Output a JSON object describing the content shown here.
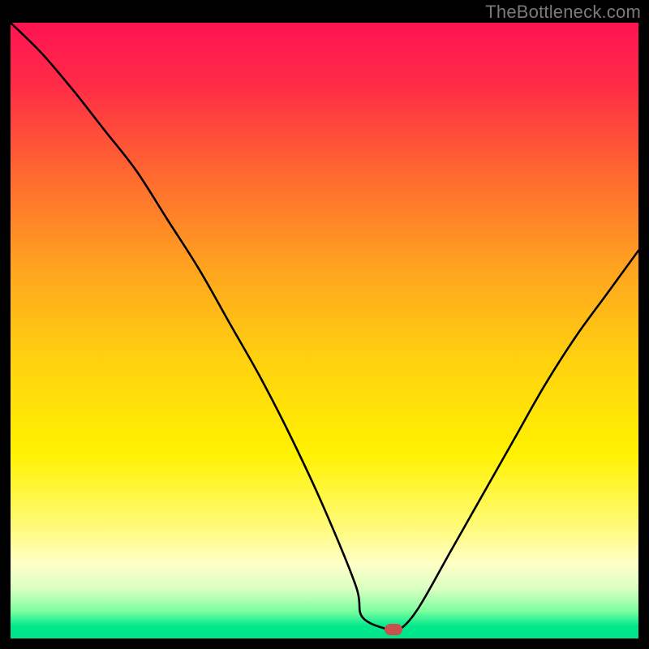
{
  "attribution": "TheBottleneck.com",
  "colors": {
    "frame": "#000000",
    "attribution_text": "#7a7a7a",
    "curve": "#000000",
    "marker": "#c9524e",
    "gradient_stops": [
      {
        "offset": 0.0,
        "color": "#ff1452"
      },
      {
        "offset": 0.1,
        "color": "#ff2b47"
      },
      {
        "offset": 0.25,
        "color": "#ff6a2f"
      },
      {
        "offset": 0.4,
        "color": "#ffa41f"
      },
      {
        "offset": 0.55,
        "color": "#ffd20f"
      },
      {
        "offset": 0.7,
        "color": "#fff200"
      },
      {
        "offset": 0.82,
        "color": "#fffb7a"
      },
      {
        "offset": 0.88,
        "color": "#ffffc8"
      },
      {
        "offset": 0.92,
        "color": "#d8ffc0"
      },
      {
        "offset": 0.955,
        "color": "#7effa0"
      },
      {
        "offset": 0.98,
        "color": "#00e98c"
      },
      {
        "offset": 1.0,
        "color": "#00e48a"
      }
    ]
  },
  "chart_data": {
    "type": "line",
    "title": "",
    "xlabel": "",
    "ylabel": "",
    "xlim": [
      0,
      100
    ],
    "ylim": [
      0,
      100
    ],
    "grid": false,
    "legend": false,
    "series": [
      {
        "name": "bottleneck-curve",
        "x": [
          0,
          5,
          10,
          15,
          20,
          25,
          30,
          35,
          40,
          45,
          50,
          55,
          56,
          60,
          62,
          65,
          70,
          75,
          80,
          85,
          90,
          95,
          100
        ],
        "values": [
          100,
          95,
          89,
          82.5,
          76,
          68,
          60,
          51,
          42,
          32,
          21,
          8.5,
          3.5,
          1.5,
          1.5,
          5,
          14,
          23,
          32,
          41,
          49,
          56,
          63
        ]
      }
    ],
    "marker": {
      "x": 61,
      "y": 1.5
    },
    "annotations": []
  }
}
